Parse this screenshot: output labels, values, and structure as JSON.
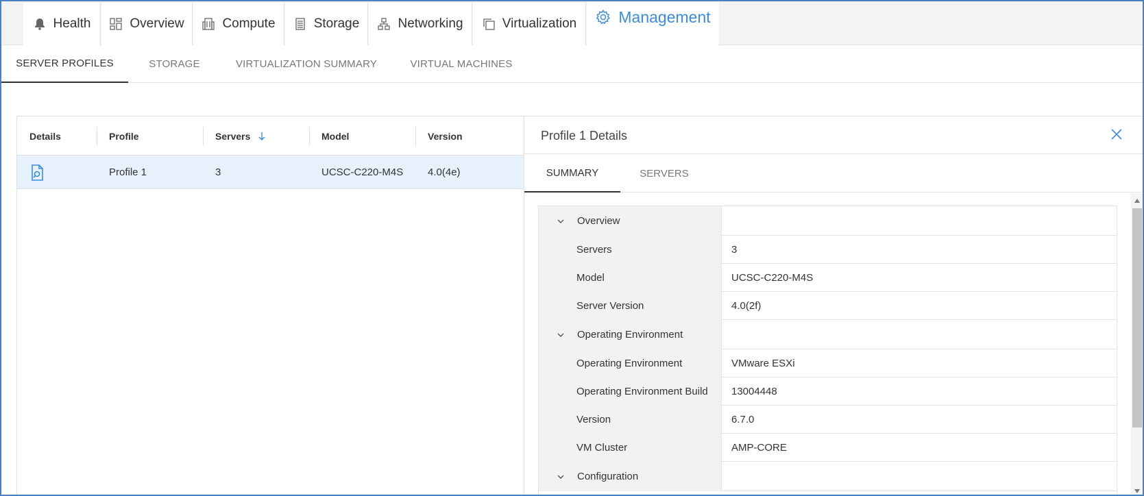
{
  "top_tabs": [
    {
      "label": "Health",
      "icon": "bell-icon"
    },
    {
      "label": "Overview",
      "icon": "dashboard-icon"
    },
    {
      "label": "Compute",
      "icon": "building-icon"
    },
    {
      "label": "Storage",
      "icon": "storage-icon"
    },
    {
      "label": "Networking",
      "icon": "network-icon"
    },
    {
      "label": "Virtualization",
      "icon": "windows-icon"
    },
    {
      "label": "Management",
      "icon": "gear-icon",
      "active": true
    }
  ],
  "sub_tabs": [
    "SERVER PROFILES",
    "STORAGE",
    "VIRTUALIZATION SUMMARY",
    "VIRTUAL MACHINES"
  ],
  "profiles_table": {
    "columns": [
      "Details",
      "Profile",
      "Servers",
      "Model",
      "Version"
    ],
    "sort_column": "Servers",
    "rows": [
      {
        "profile": "Profile 1",
        "servers": "3",
        "model": "UCSC-C220-M4S",
        "version": "4.0(4e)"
      }
    ]
  },
  "details_panel": {
    "title": "Profile 1 Details",
    "tabs": [
      "SUMMARY",
      "SERVERS"
    ],
    "active_tab": "SUMMARY",
    "sections": [
      {
        "label": "Overview"
      },
      {
        "label": "Servers",
        "value": "3"
      },
      {
        "label": "Model",
        "value": "UCSC-C220-M4S"
      },
      {
        "label": "Server Version",
        "value": "4.0(2f)"
      },
      {
        "label": "Operating Environment"
      },
      {
        "label": "Operating Environment",
        "value": "VMware ESXi"
      },
      {
        "label": "Operating Environment Build",
        "value": "13004448"
      },
      {
        "label": "Version",
        "value": "6.7.0"
      },
      {
        "label": "VM Cluster",
        "value": "AMP-CORE"
      },
      {
        "label": "Configuration"
      }
    ]
  },
  "colors": {
    "accent": "#3a8dde",
    "selected_row": "#e6f1fb",
    "frame_border": "#4a7fc1"
  }
}
